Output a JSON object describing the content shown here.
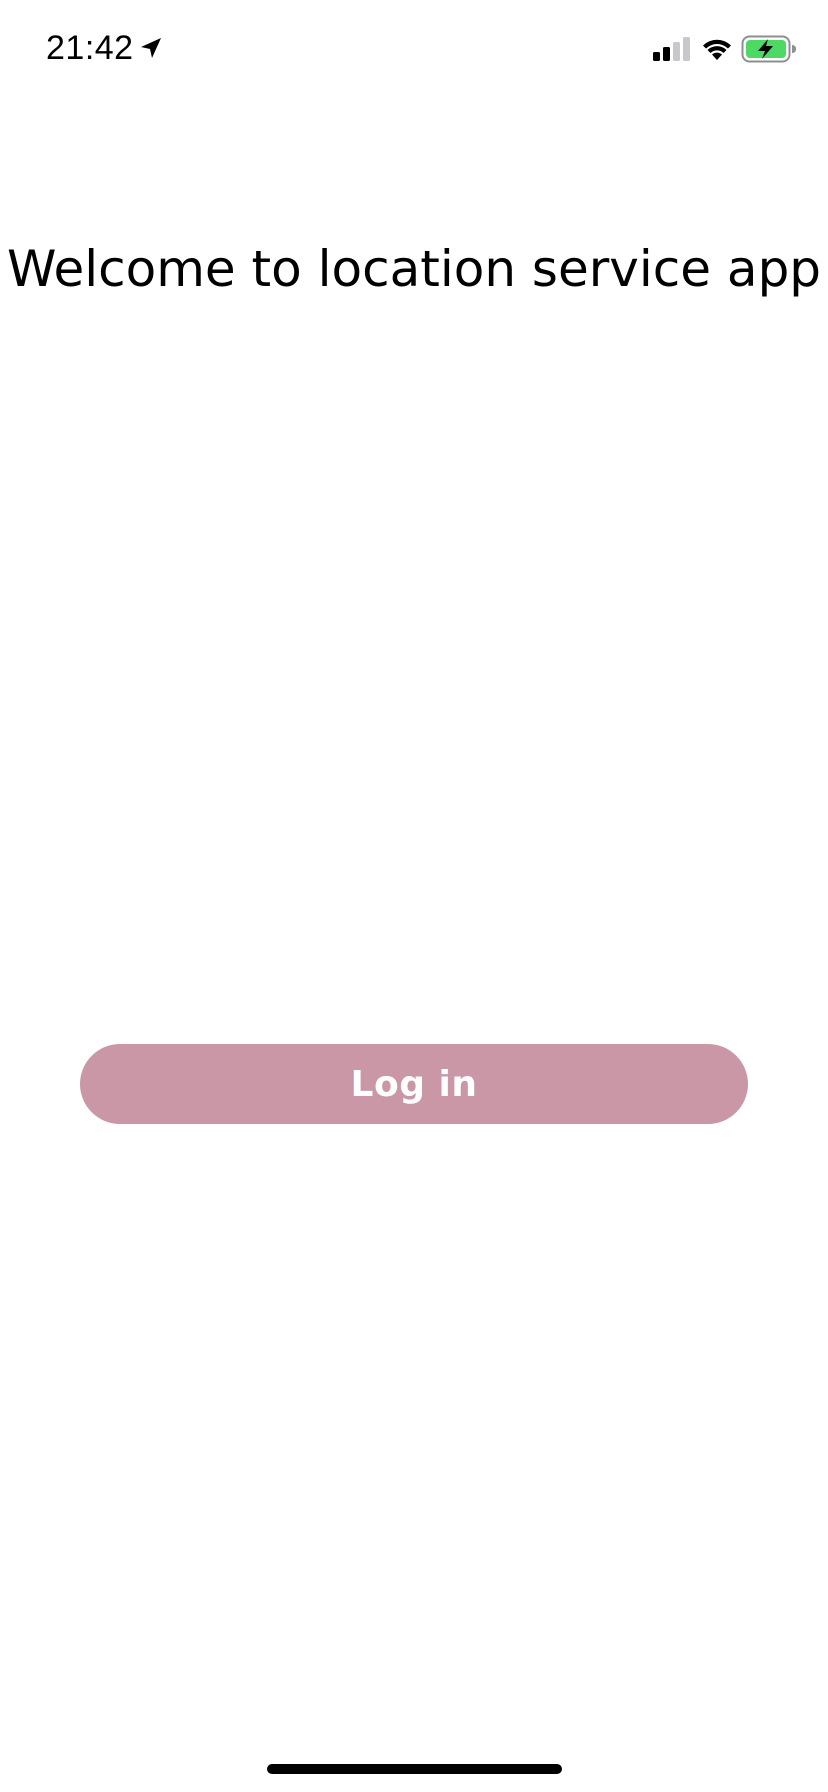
{
  "status_bar": {
    "time": "21:42",
    "location_icon": "location-arrow-icon",
    "signal_icon": "cellular-signal-icon",
    "wifi_icon": "wifi-icon",
    "battery_icon": "battery-charging-icon",
    "battery_color": "#4cd964"
  },
  "main": {
    "title": "Welcome to location service app",
    "login_button": {
      "label": "Log in",
      "color": "#c997a6"
    }
  },
  "home_indicator": {
    "icon": "home-indicator-bar"
  }
}
